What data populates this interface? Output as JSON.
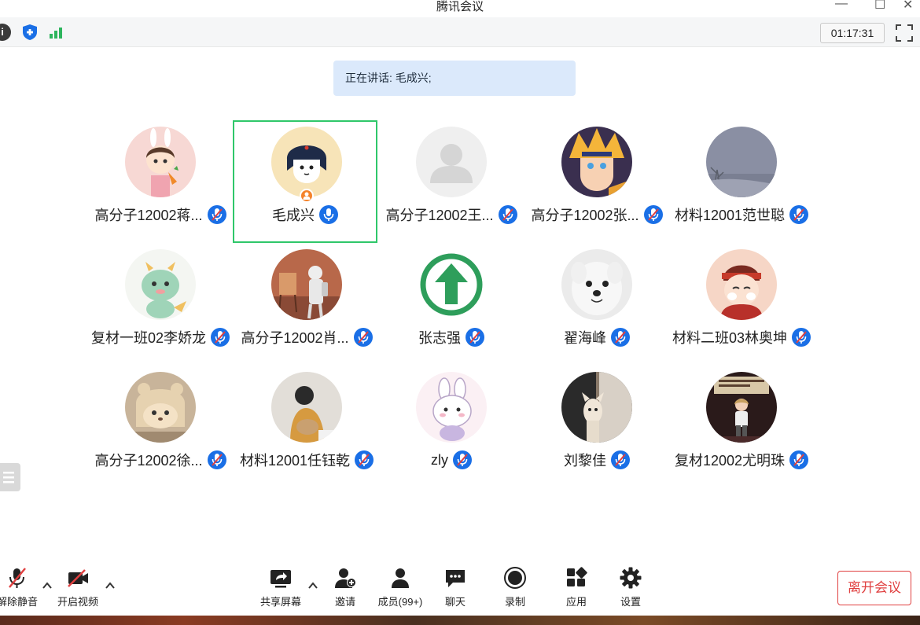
{
  "window": {
    "title": "腾讯会议"
  },
  "top_toolbar": {
    "timer": "01:17:31"
  },
  "speaking_banner": {
    "text": "正在讲话: 毛成兴;"
  },
  "participants": [
    {
      "name": "高分子12002蒋...",
      "avatar": "cartoon-girl-carrot",
      "mic": "muted",
      "active": false
    },
    {
      "name": "毛成兴",
      "avatar": "cartoon-hat-face",
      "mic": "on",
      "active": true,
      "host": true
    },
    {
      "name": "高分子12002王...",
      "avatar": "default-person",
      "mic": "muted",
      "active": false
    },
    {
      "name": "高分子12002张...",
      "avatar": "anime-boy",
      "mic": "muted",
      "active": false
    },
    {
      "name": "材料12001范世聪",
      "avatar": "grey-sky",
      "mic": "muted",
      "active": false
    },
    {
      "name": "复材一班02李娇龙",
      "avatar": "cartoon-dragon",
      "mic": "muted",
      "active": false
    },
    {
      "name": "高分子12002肖...",
      "avatar": "painter-photo",
      "mic": "muted",
      "active": false
    },
    {
      "name": "张志强",
      "avatar": "green-up-arrow",
      "mic": "muted",
      "active": false
    },
    {
      "name": "翟海峰",
      "avatar": "white-dog",
      "mic": "muted",
      "active": false
    },
    {
      "name": "材料二班03林奥坤",
      "avatar": "cartoon-boy-red",
      "mic": "muted",
      "active": false
    },
    {
      "name": "高分子12002徐...",
      "avatar": "cat-hat",
      "mic": "muted",
      "active": false
    },
    {
      "name": "材料12001任钰乾",
      "avatar": "person-hat-photo",
      "mic": "muted",
      "active": false
    },
    {
      "name": "zly",
      "avatar": "cartoon-bunny",
      "mic": "muted",
      "active": false
    },
    {
      "name": "刘黎佳",
      "avatar": "dog-door",
      "mic": "muted",
      "active": false
    },
    {
      "name": "复材12002尤明珠",
      "avatar": "child-stage",
      "mic": "muted",
      "active": false
    }
  ],
  "bottom_toolbar": {
    "unmute": "解除静音",
    "start_video": "开启视频",
    "share_screen": "共享屏幕",
    "invite": "邀请",
    "members": "成员(99+)",
    "chat": "聊天",
    "record": "录制",
    "apps": "应用",
    "settings": "设置",
    "leave": "离开会议"
  },
  "colors": {
    "accent": "#1a6fe6",
    "active_border": "#2fc76a",
    "leave": "#e04040",
    "banner_bg": "#dbe9fb"
  }
}
